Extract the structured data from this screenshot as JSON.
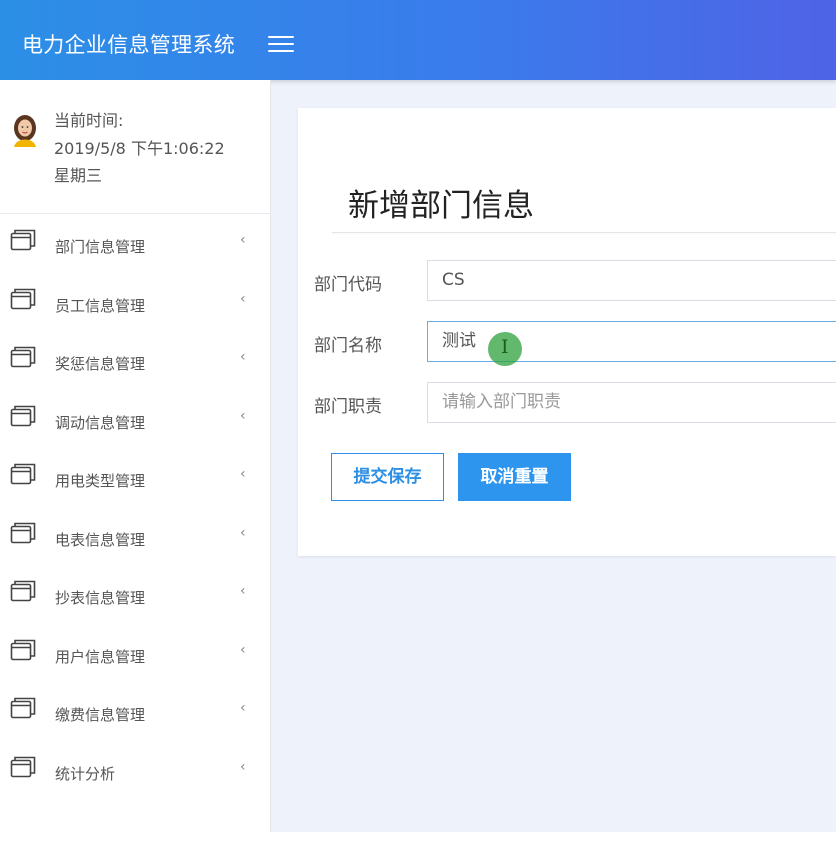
{
  "header": {
    "app_title": "电力企业信息管理系统"
  },
  "user_panel": {
    "time_label": "当前时间:",
    "time_value": "2019/5/8 下午1:06:22",
    "weekday": "星期三"
  },
  "sidebar": {
    "items": [
      {
        "label": "部门信息管理"
      },
      {
        "label": "员工信息管理"
      },
      {
        "label": "奖惩信息管理"
      },
      {
        "label": "调动信息管理"
      },
      {
        "label": "用电类型管理"
      },
      {
        "label": "电表信息管理"
      },
      {
        "label": "抄表信息管理"
      },
      {
        "label": "用户信息管理"
      },
      {
        "label": "缴费信息管理"
      },
      {
        "label": "统计分析"
      }
    ],
    "chevron": "‹"
  },
  "form": {
    "title": "新增部门信息",
    "dept_code": {
      "label": "部门代码",
      "value": "CS"
    },
    "dept_name": {
      "label": "部门名称",
      "value": "测试"
    },
    "dept_duty": {
      "label": "部门职责",
      "placeholder": "请输入部门职责"
    },
    "submit_label": "提交保存",
    "reset_label": "取消重置"
  },
  "colors": {
    "header_start": "#2c8fe6",
    "header_end": "#4f63e6",
    "accent": "#2d95ee"
  }
}
